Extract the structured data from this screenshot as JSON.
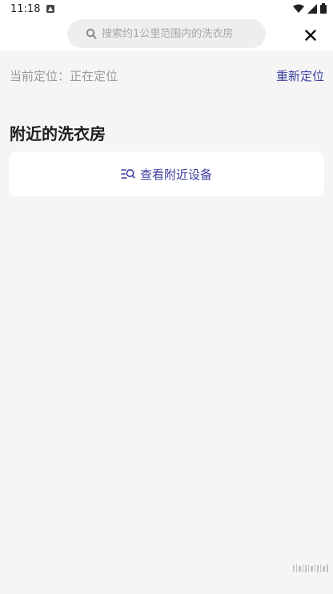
{
  "status_bar": {
    "time": "11:18"
  },
  "search": {
    "placeholder": "搜索约1公里范围内的洗衣房"
  },
  "location": {
    "label": "当前定位：正在定位",
    "relocate": "重新定位"
  },
  "nearby": {
    "title": "附近的洗衣房",
    "view_devices": "查看附近设备"
  },
  "colors": {
    "accent": "#3c3f9e",
    "background": "#f5f5f5",
    "card": "#ffffff",
    "search_bg": "#eeeeee"
  }
}
